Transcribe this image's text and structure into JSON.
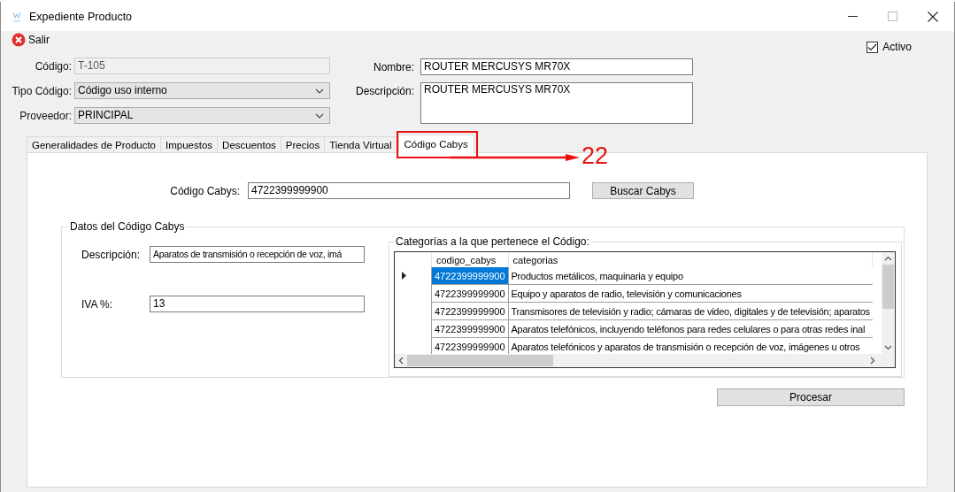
{
  "window": {
    "title": "Expediente Producto"
  },
  "toolbar": {
    "exit_label": "Salir",
    "active_checkbox": {
      "label": "Activo",
      "checked": true
    }
  },
  "form_left": [
    {
      "label": "Código:",
      "kind": "text",
      "value": "T-105",
      "disabled": true
    },
    {
      "label": "Tipo Código:",
      "kind": "select",
      "value": "Código uso interno",
      "disabled": false
    },
    {
      "label": "Proveedor:",
      "kind": "select",
      "value": "PRINCIPAL",
      "disabled": false
    }
  ],
  "form_right": [
    {
      "label": "Nombre:",
      "kind": "text",
      "value": "ROUTER MERCUSYS MR70X"
    },
    {
      "label": "Descripción:",
      "kind": "multiline",
      "value": "ROUTER MERCUSYS MR70X"
    }
  ],
  "tabs": [
    {
      "label": "Generalidades de Producto",
      "selected": false
    },
    {
      "label": "Impuestos",
      "selected": false
    },
    {
      "label": "Descuentos",
      "selected": false
    },
    {
      "label": "Precios",
      "selected": false
    },
    {
      "label": "Tienda Virtual",
      "selected": false
    },
    {
      "label": "Código Cabys",
      "selected": true
    }
  ],
  "annotation": {
    "label": "22"
  },
  "cabys": {
    "label": "Código Cabys:",
    "value": "4722399999900",
    "search_button": "Buscar Cabys"
  },
  "details_group": {
    "title": "Datos del Código Cabys",
    "fields": [
      {
        "label": "Descripción:",
        "value": "Aparatos de transmisión o recepción de voz, imá"
      },
      {
        "label": "IVA %:",
        "value": "13"
      }
    ],
    "categories": {
      "title": "Categorías a la que pertenece el Código:",
      "columns": [
        "codigo_cabys",
        "categorias"
      ],
      "rows": [
        {
          "codigo_cabys": "4722399999900",
          "categorias": "Productos metálicos, maquinaria y equipo",
          "selected": true
        },
        {
          "codigo_cabys": "4722399999900",
          "categorias": "Equipo y aparatos de radio, televisión y comunicaciones",
          "selected": false
        },
        {
          "codigo_cabys": "4722399999900",
          "categorias": "Transmisores de televisión y radio; cámaras de video, digitales y de televisión; aparatos",
          "selected": false
        },
        {
          "codigo_cabys": "4722399999900",
          "categorias": "Aparatos telefónicos, incluyendo teléfonos para redes celulares o para otras redes inal",
          "selected": false
        },
        {
          "codigo_cabys": "4722399999900",
          "categorias": "Aparatos telefónicos y aparatos de transmisión o recepción de voz, imágenes u otros",
          "selected": false
        }
      ]
    }
  },
  "process_button": "Procesar"
}
